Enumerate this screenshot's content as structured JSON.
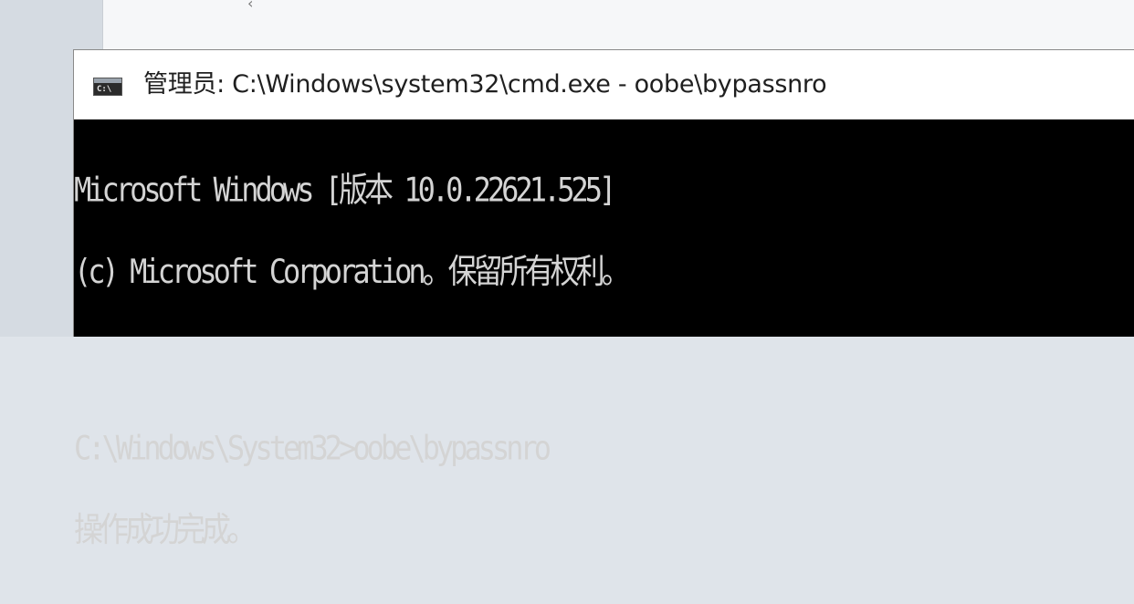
{
  "titlebar": {
    "icon": "cmd-console-icon",
    "icon_glyph": "C:\\",
    "title": "管理员: C:\\Windows\\system32\\cmd.exe - oobe\\bypassnro"
  },
  "console": {
    "lines": [
      "Microsoft Windows [版本 10.0.22621.525]",
      "(c) Microsoft Corporation。保留所有权利。",
      "C:\\Windows\\System32>oobe\\bypassnro",
      "操作成功完成。"
    ]
  },
  "colors": {
    "console_bg": "#000000",
    "console_text": "#d4d4d4",
    "titlebar_bg": "#ffffff"
  }
}
